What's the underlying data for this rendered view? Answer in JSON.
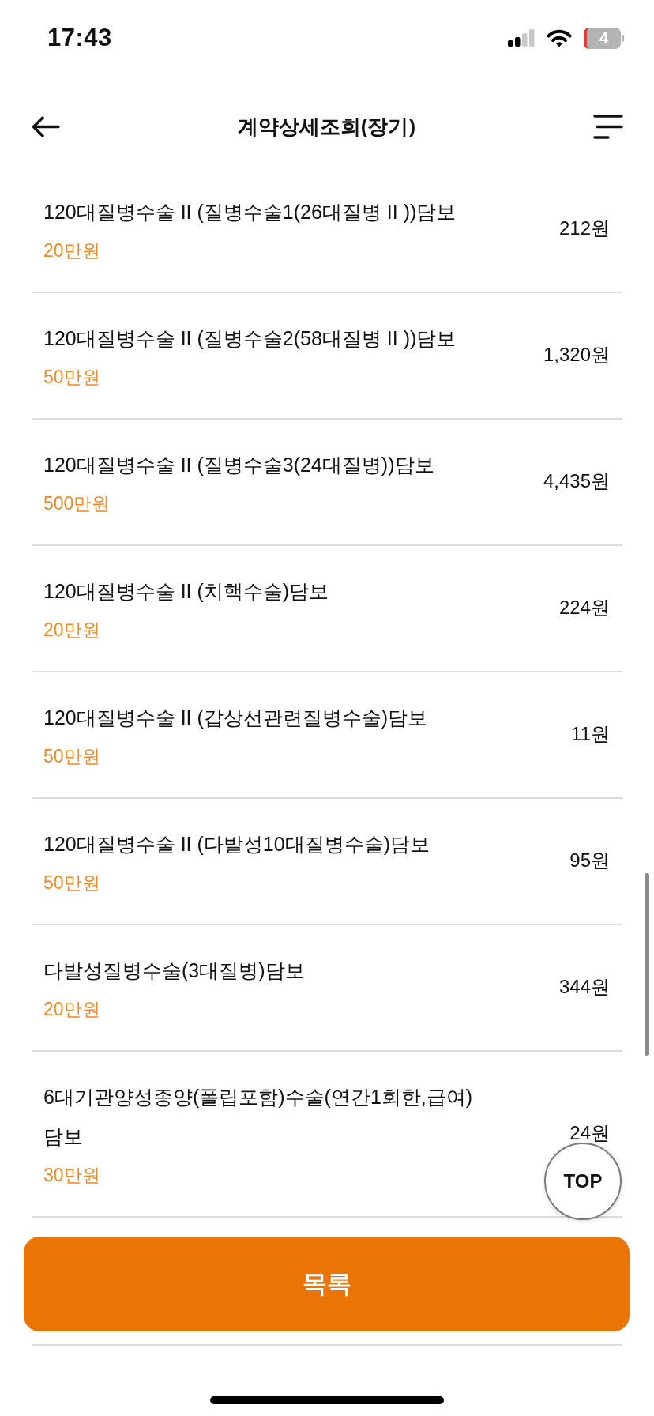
{
  "status_bar": {
    "time": "17:43",
    "battery": "4"
  },
  "header": {
    "title": "계약상세조회(장기)"
  },
  "coverages": [
    {
      "name": "120대질병수술 II (질병수술1(26대질병 II ))담보",
      "amount": "20만원",
      "premium": "212원"
    },
    {
      "name": "120대질병수술 II (질병수술2(58대질병 II ))담보",
      "amount": "50만원",
      "premium": "1,320원"
    },
    {
      "name": "120대질병수술 II (질병수술3(24대질병))담보",
      "amount": "500만원",
      "premium": "4,435원"
    },
    {
      "name": "120대질병수술 II (치핵수술)담보",
      "amount": "20만원",
      "premium": "224원"
    },
    {
      "name": "120대질병수술 II (갑상선관련질병수술)담보",
      "amount": "50만원",
      "premium": "11원"
    },
    {
      "name": "120대질병수술 II (다발성10대질병수술)담보",
      "amount": "50만원",
      "premium": "95원"
    },
    {
      "name": "다발성질병수술(3대질병)담보",
      "amount": "20만원",
      "premium": "344원"
    },
    {
      "name": "6대기관양성종양(폴립포함)수술(연간1회한,급여)담보",
      "amount": "30만원",
      "premium": "24원"
    }
  ],
  "top_button": {
    "label": "TOP"
  },
  "footer": {
    "list_button": "목록"
  }
}
